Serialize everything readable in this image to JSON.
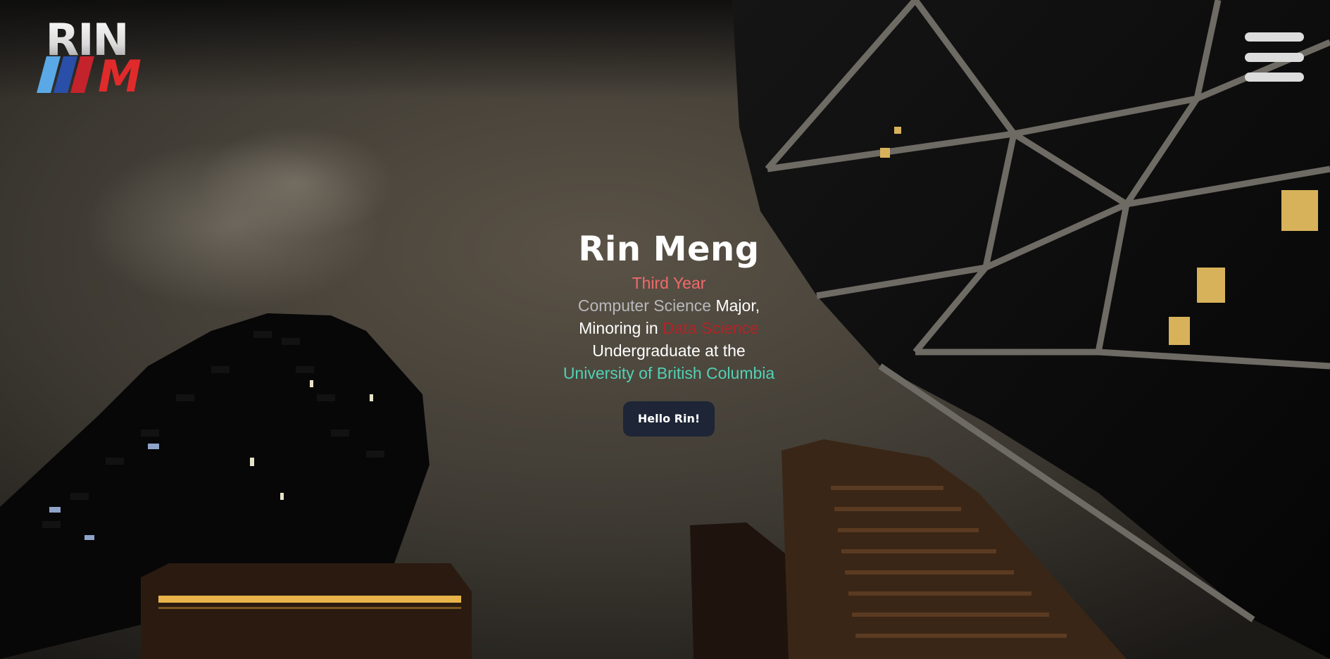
{
  "logo": {
    "text_top": "RIN",
    "text_bottom": "M",
    "stripe_colors": [
      "#5aa9e6",
      "#2a4fa8",
      "#c4232b"
    ]
  },
  "menu": {
    "icon": "hamburger-menu-icon"
  },
  "hero": {
    "name": "Rin Meng",
    "year": "Third Year",
    "major_field": "Computer Science",
    "major_suffix": " Major,",
    "minor_prefix": "Minoring in ",
    "minor_field": "Data Science",
    "undergrad_line": "Undergraduate at the",
    "university": "University of British Columbia",
    "button_label": "Hello Rin!"
  },
  "colors": {
    "year": "#f06a6a",
    "major": "#b8b8bc",
    "minor": "#b02528",
    "university": "#52d1b4",
    "button_bg": "#1d2536"
  }
}
